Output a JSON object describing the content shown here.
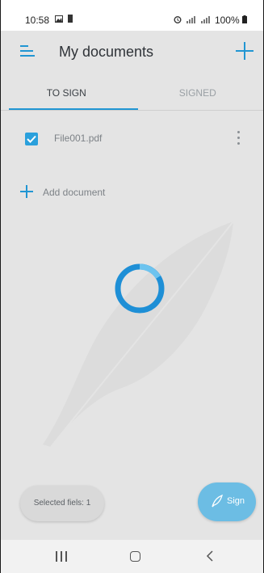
{
  "status_bar": {
    "time": "10:58",
    "left_icons": [
      "image-icon",
      "notification-icon"
    ],
    "right_icons": [
      "alarm-icon",
      "signal-icon",
      "signal-icon"
    ],
    "battery": "100%"
  },
  "header": {
    "title": "My documents",
    "menu_icon": "menu-icon",
    "add_icon": "plus-icon"
  },
  "tabs": [
    {
      "label": "TO SIGN",
      "active": true
    },
    {
      "label": "SIGNED",
      "active": false
    }
  ],
  "files": [
    {
      "name": "File001.pdf",
      "checked": true
    }
  ],
  "add_document": {
    "label": "Add document"
  },
  "footer": {
    "selected_label": "Selected fiels: 1",
    "sign_label": "Sign",
    "sign_icon": "pen-icon"
  },
  "colors": {
    "accent": "#2196d3",
    "background": "#e4e4e4",
    "sign_button": "#6cbde4"
  }
}
